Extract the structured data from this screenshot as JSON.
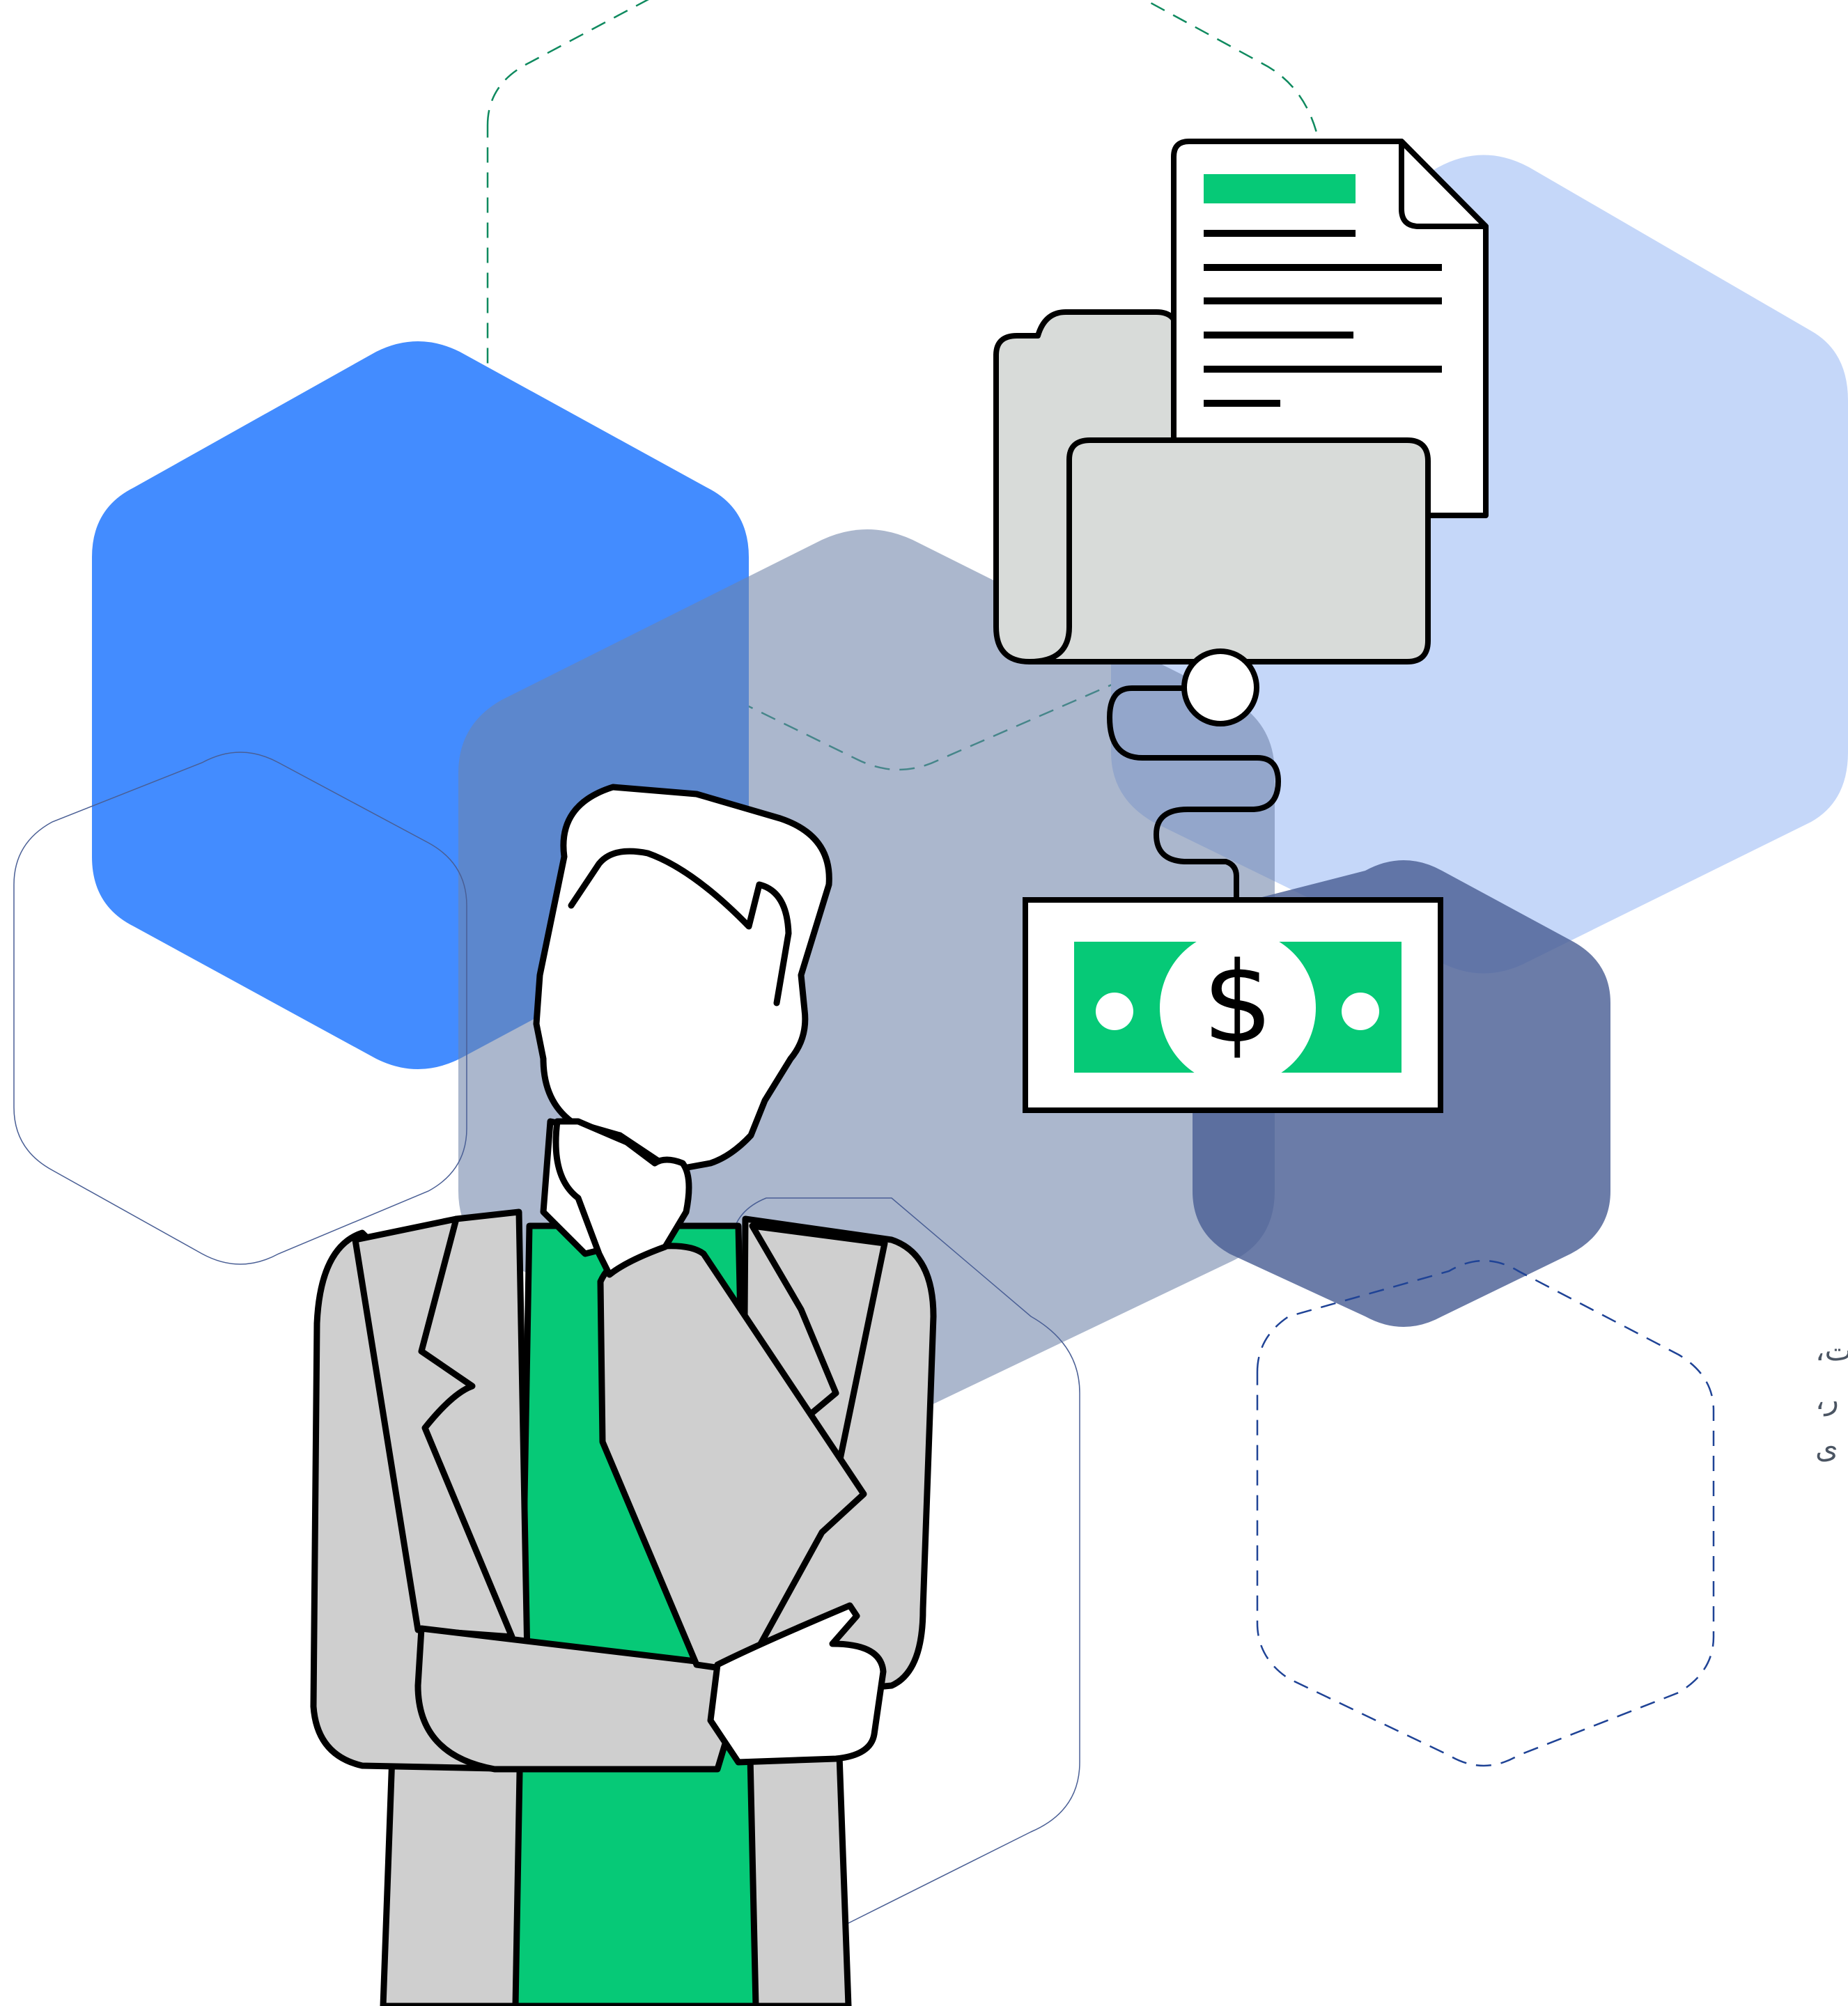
{
  "illustration": {
    "colors": {
      "blue": "#438cff",
      "light_blue": "#c5d7f9",
      "slate": "#98a4bf",
      "navy": "#4a5f95",
      "green": "#06c977",
      "gray": "#cfcfcf",
      "light_gray": "#d8dbd9",
      "outline": "#000000",
      "text": "#4b5563"
    },
    "icons": [
      "document-icon",
      "folder-icon",
      "dollar-bill-icon",
      "connector-icon",
      "thinking-man"
    ],
    "currency_symbol": "$"
  },
  "side_text": {
    "lines": [
      "ت،",
      "ر،",
      "ی"
    ]
  }
}
